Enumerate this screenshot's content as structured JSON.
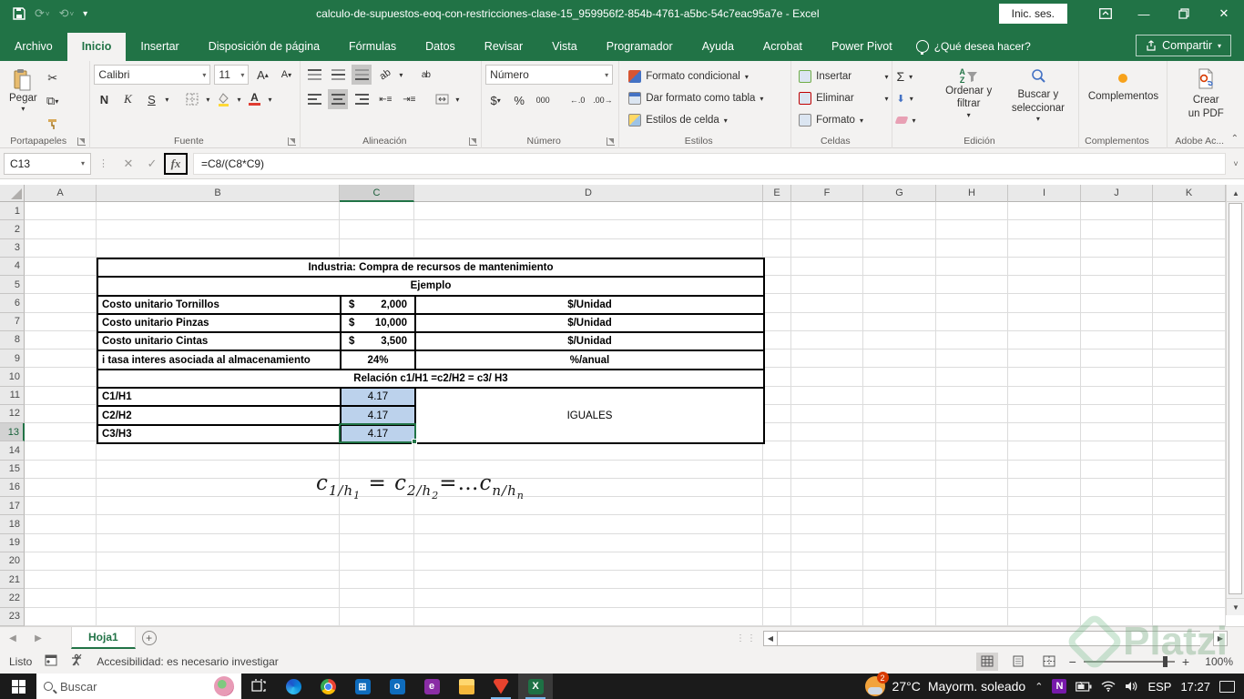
{
  "titlebar": {
    "title": "calculo-de-supuestos-eoq-con-restricciones-clase-15_959956f2-854b-4761-a5bc-54c7eac95a7e  -  Excel",
    "signin": "Inic. ses."
  },
  "tabs": {
    "items": [
      "Archivo",
      "Inicio",
      "Insertar",
      "Disposición de página",
      "Fórmulas",
      "Datos",
      "Revisar",
      "Vista",
      "Programador",
      "Ayuda",
      "Acrobat",
      "Power Pivot"
    ],
    "active": "Inicio",
    "help": "¿Qué desea hacer?",
    "share": "Compartir"
  },
  "ribbon": {
    "paste": "Pegar",
    "clipboard_group": "Portapapeles",
    "font_group": "Fuente",
    "font_name": "Calibri",
    "font_size": "11",
    "bold": "N",
    "italic": "K",
    "underline": "S",
    "align_group": "Alineación",
    "number_format": "Número",
    "number_group": "Número",
    "thousands": "000",
    "percent": "%",
    "currency": "$",
    "conditional_format": "Formato condicional",
    "format_as_table": "Dar formato como tabla",
    "cell_styles": "Estilos de celda",
    "styles_group": "Estilos",
    "insert": "Insertar",
    "delete": "Eliminar",
    "format": "Formato",
    "cells_group": "Celdas",
    "sort_filter": "Ordenar y filtrar",
    "find_select": "Buscar y seleccionar",
    "editing_group": "Edición",
    "addins_button": "Complementos",
    "addins_group": "Complementos",
    "create_pdf_line1": "Crear",
    "create_pdf_line2": "un PDF",
    "adobe_group": "Adobe Ac..."
  },
  "formula_bar": {
    "name_box": "C13",
    "formula": "=C8/(C8*C9)"
  },
  "sheet": {
    "columns": [
      "A",
      "B",
      "C",
      "D",
      "E",
      "F",
      "G",
      "H",
      "I",
      "J",
      "K"
    ],
    "selected_column": "C",
    "visible_rows": 23,
    "selected_row": 13,
    "table": {
      "title": "Industria: Compra de recursos de mantenimiento",
      "subtitle": "Ejemplo",
      "items": [
        {
          "label": "Costo unitario Tornillos",
          "currency": "$",
          "value": "2,000",
          "unit": "$/Unidad"
        },
        {
          "label": "Costo unitario Pinzas",
          "currency": "$",
          "value": "10,000",
          "unit": "$/Unidad"
        },
        {
          "label": "Costo unitario Cintas",
          "currency": "$",
          "value": "3,500",
          "unit": "$/Unidad"
        },
        {
          "label": "i tasa interes asociada al almacenamiento",
          "currency": "",
          "value": "24%",
          "unit": "%/anual"
        }
      ],
      "relation_header": "Relación c1/H1 =c2/H2 = c3/ H3",
      "ratios": [
        {
          "label": "C1/H1",
          "value": "4.17"
        },
        {
          "label": "C2/H2",
          "value": "4.17"
        },
        {
          "label": "C3/H3",
          "value": "4.17"
        }
      ],
      "ratio_note": "IGUALES"
    },
    "formula_note": {
      "terms": [
        {
          "base": "c",
          "sub": "1/h",
          "subsub": "1"
        },
        {
          "base": "c",
          "sub": "2/h",
          "subsub": "2"
        },
        {
          "base": "c",
          "sub": "n/h",
          "subsub": "n"
        }
      ],
      "eq1": " = ",
      "eq2": "=…"
    }
  },
  "sheet_tabs": {
    "active": "Hoja1"
  },
  "status_bar": {
    "mode": "Listo",
    "accessibility": "Accesibilidad: es necesario investigar",
    "zoom": "100%"
  },
  "taskbar": {
    "search_placeholder": "Buscar",
    "weather_temp": "27°C",
    "weather_text": "Mayorm. soleado",
    "language": "ESP",
    "time": "17:27"
  },
  "watermark": "Platzi",
  "colors": {
    "excel_green": "#217346",
    "ratio_fill": "#bcd2ec",
    "taskbar": "#1b1b1b"
  }
}
